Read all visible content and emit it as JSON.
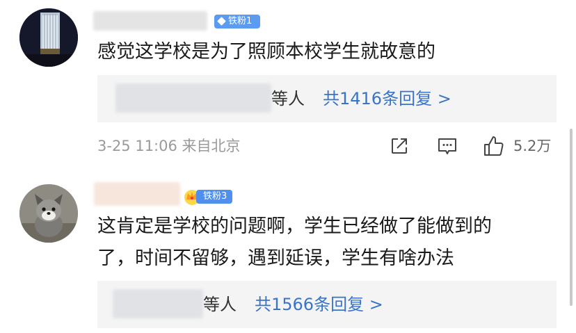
{
  "comments": [
    {
      "badge_label": "铁粉1",
      "text": "感觉这学校是为了照顾本校学生就故意的",
      "replies": {
        "suffix": "等人",
        "count_label": "共1416条回复 >"
      },
      "meta": {
        "time": "3-25 11:06",
        "location": "来自北京"
      },
      "likes": "5.2万"
    },
    {
      "badge_label": "铁粉3",
      "text_lines": [
        "这肯定是学校的问题啊，学生已经做了能做到的",
        "了，时间不留够，遇到延误，学生有啥办法"
      ],
      "replies": {
        "suffix": "等人",
        "count_label": "共1566条回复 >"
      }
    }
  ],
  "colors": {
    "badge": "#5b9cf2",
    "link": "#3a74c6",
    "meta": "#9a9a9a",
    "reply_bg": "#f4f4f4"
  },
  "icons": [
    "share-icon",
    "comment-icon",
    "like-icon",
    "crown-icon",
    "diamond-icon"
  ]
}
